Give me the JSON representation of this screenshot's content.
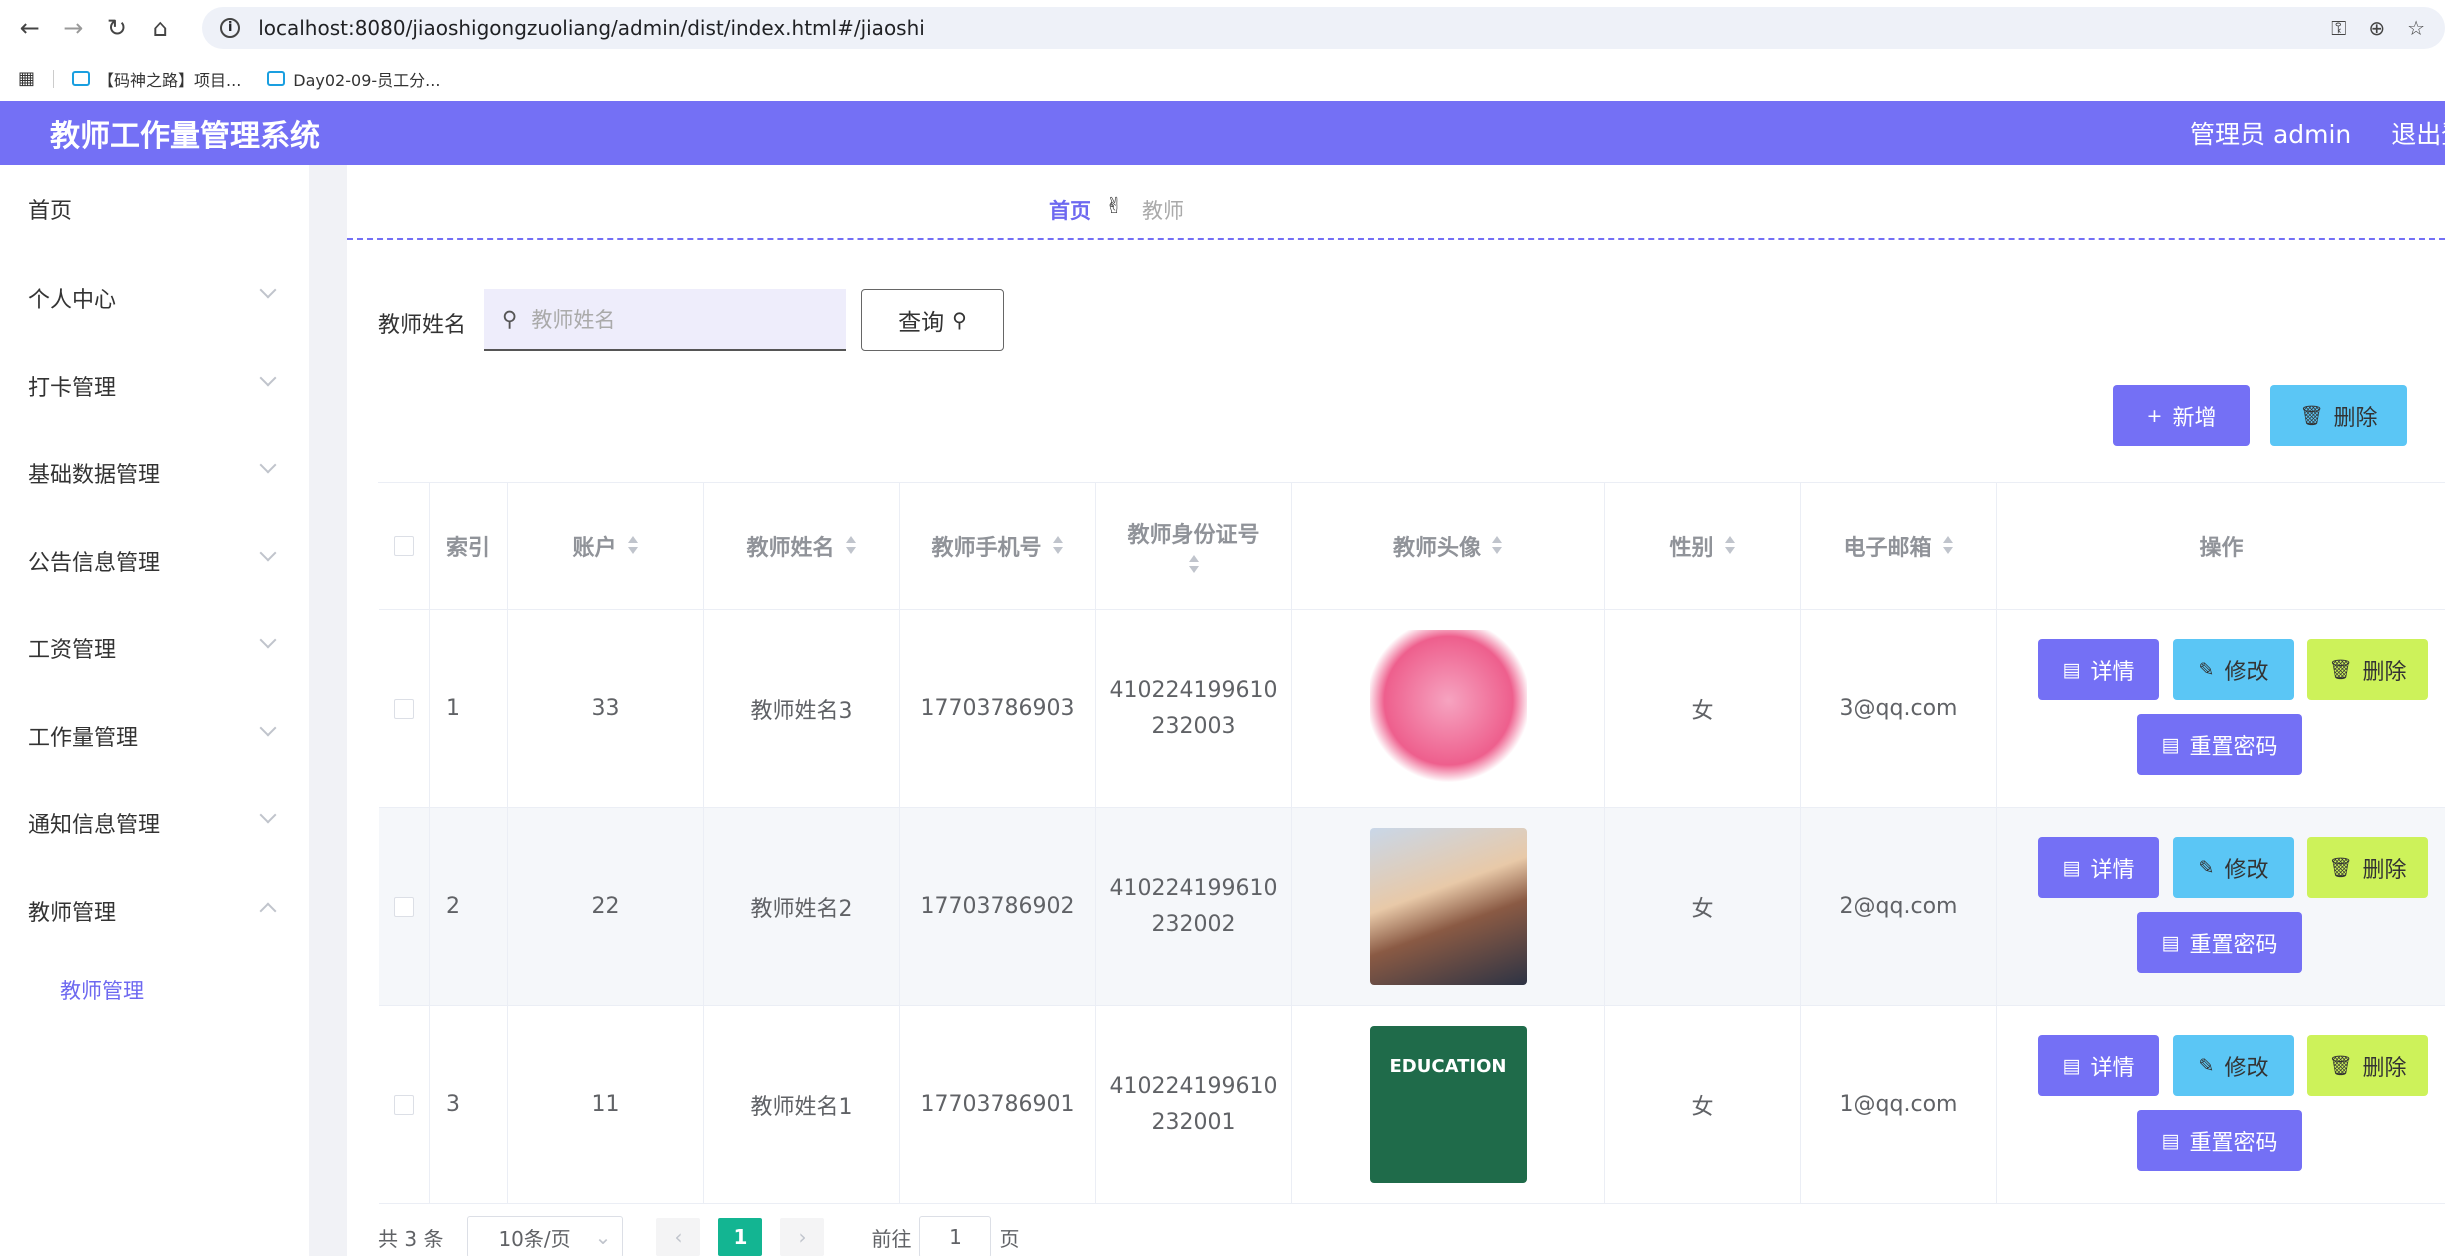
{
  "browser": {
    "url": "localhost:8080/jiaoshigongzuoliang/admin/dist/index.html#/jiaoshi",
    "bookmarks": [
      "【码神之路】项目...",
      "Day02-09-员工分..."
    ]
  },
  "header": {
    "title": "教师工作量管理系统",
    "user": "管理员 admin",
    "logout": "退出登"
  },
  "sidebar": {
    "items": [
      {
        "label": "首页"
      },
      {
        "label": "个人中心"
      },
      {
        "label": "打卡管理"
      },
      {
        "label": "基础数据管理"
      },
      {
        "label": "公告信息管理"
      },
      {
        "label": "工资管理"
      },
      {
        "label": "工作量管理"
      },
      {
        "label": "通知信息管理"
      },
      {
        "label": "教师管理"
      }
    ],
    "sub_item": "教师管理"
  },
  "breadcrumb": {
    "home": "首页",
    "current": "教师"
  },
  "search": {
    "label": "教师姓名",
    "placeholder": "教师姓名",
    "query_button": "查询"
  },
  "actions": {
    "add": "新增",
    "delete": "删除"
  },
  "table": {
    "headers": [
      "索引",
      "账户",
      "教师姓名",
      "教师手机号",
      "教师身份证号",
      "教师头像",
      "性别",
      "电子邮箱",
      "操作"
    ],
    "rows": [
      {
        "index": "1",
        "account": "33",
        "name": "教师姓名3",
        "phone": "17703786903",
        "id_line1": "410224199610",
        "id_line2": "232003",
        "gender": "女",
        "email": "3@qq.com"
      },
      {
        "index": "2",
        "account": "22",
        "name": "教师姓名2",
        "phone": "17703786902",
        "id_line1": "410224199610",
        "id_line2": "232002",
        "gender": "女",
        "email": "2@qq.com"
      },
      {
        "index": "3",
        "account": "11",
        "name": "教师姓名1",
        "phone": "17703786901",
        "id_line1": "410224199610",
        "id_line2": "232001",
        "gender": "女",
        "email": "1@qq.com"
      }
    ],
    "op_labels": {
      "detail": "详情",
      "edit": "修改",
      "delete": "删除",
      "reset": "重置密码"
    },
    "edu_text": "EDUCATION"
  },
  "pagination": {
    "total": "共 3 条",
    "page_size": "10条/页",
    "current_page": "1",
    "goto_prefix": "前往",
    "goto_value": "1",
    "goto_suffix": "页"
  },
  "colors": {
    "primary": "#7470f5",
    "info": "#5bc6f5",
    "danger_lime": "#cdf25a",
    "pager_active": "#13b592"
  }
}
